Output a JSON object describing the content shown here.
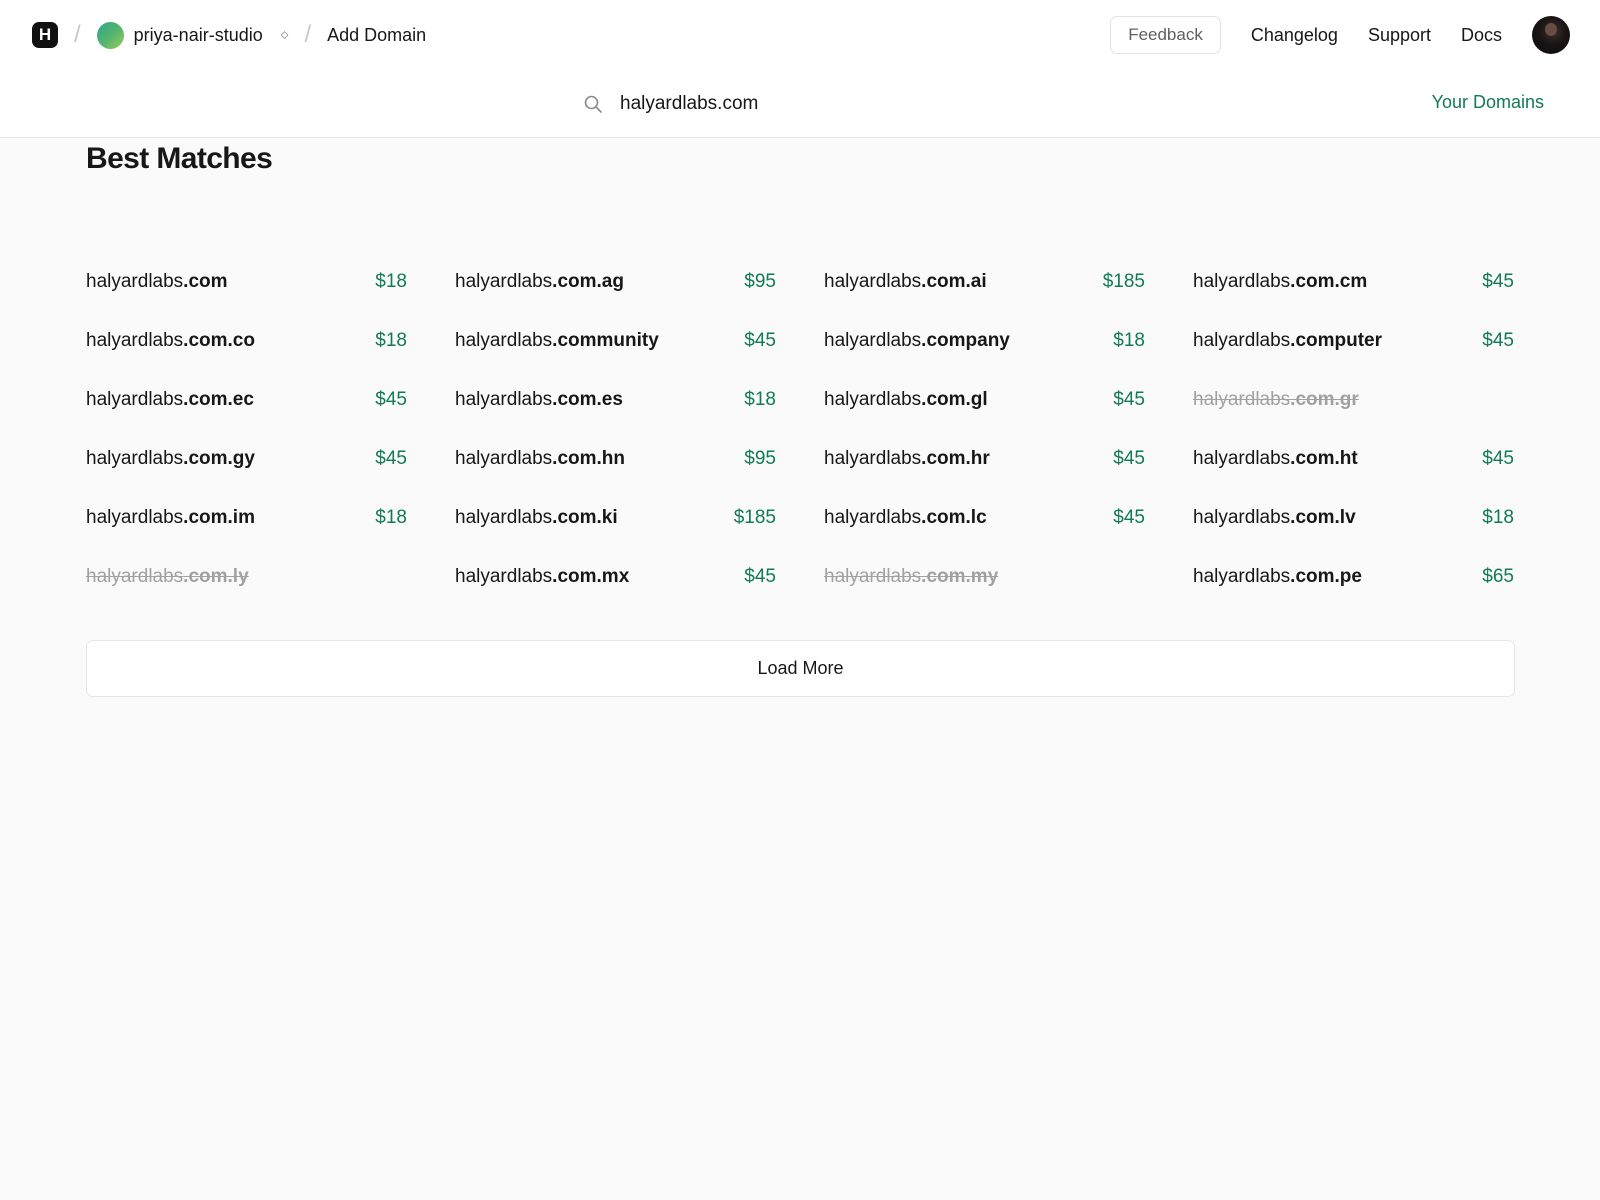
{
  "nav": {
    "logo_letter": "H",
    "team_name": "priya-nair-studio",
    "team_switch_glyph": "⬦",
    "page": "Add Domain",
    "feedback": "Feedback",
    "links": [
      "Changelog",
      "Support",
      "Docs"
    ]
  },
  "search": {
    "query": "halyardlabs.com",
    "your_domains": "Your Domains"
  },
  "section_title": "Best Matches",
  "results": [
    {
      "base": "halyardlabs",
      "tld": ".com",
      "price": "$18",
      "available": true
    },
    {
      "base": "halyardlabs",
      "tld": ".com.ag",
      "price": "$95",
      "available": true
    },
    {
      "base": "halyardlabs",
      "tld": ".com.ai",
      "price": "$185",
      "available": true
    },
    {
      "base": "halyardlabs",
      "tld": ".com.cm",
      "price": "$45",
      "available": true
    },
    {
      "base": "halyardlabs",
      "tld": ".com.co",
      "price": "$18",
      "available": true
    },
    {
      "base": "halyardlabs",
      "tld": ".community",
      "price": "$45",
      "available": true
    },
    {
      "base": "halyardlabs",
      "tld": ".company",
      "price": "$18",
      "available": true
    },
    {
      "base": "halyardlabs",
      "tld": ".computer",
      "price": "$45",
      "available": true
    },
    {
      "base": "halyardlabs",
      "tld": ".com.ec",
      "price": "$45",
      "available": true
    },
    {
      "base": "halyardlabs",
      "tld": ".com.es",
      "price": "$18",
      "available": true
    },
    {
      "base": "halyardlabs",
      "tld": ".com.gl",
      "price": "$45",
      "available": true
    },
    {
      "base": "halyardlabs",
      "tld": ".com.gr",
      "price": "",
      "available": false
    },
    {
      "base": "halyardlabs",
      "tld": ".com.gy",
      "price": "$45",
      "available": true
    },
    {
      "base": "halyardlabs",
      "tld": ".com.hn",
      "price": "$95",
      "available": true
    },
    {
      "base": "halyardlabs",
      "tld": ".com.hr",
      "price": "$45",
      "available": true
    },
    {
      "base": "halyardlabs",
      "tld": ".com.ht",
      "price": "$45",
      "available": true
    },
    {
      "base": "halyardlabs",
      "tld": ".com.im",
      "price": "$18",
      "available": true
    },
    {
      "base": "halyardlabs",
      "tld": ".com.ki",
      "price": "$185",
      "available": true
    },
    {
      "base": "halyardlabs",
      "tld": ".com.lc",
      "price": "$45",
      "available": true
    },
    {
      "base": "halyardlabs",
      "tld": ".com.lv",
      "price": "$18",
      "available": true
    },
    {
      "base": "halyardlabs",
      "tld": ".com.ly",
      "price": "",
      "available": false
    },
    {
      "base": "halyardlabs",
      "tld": ".com.mx",
      "price": "$45",
      "available": true
    },
    {
      "base": "halyardlabs",
      "tld": ".com.my",
      "price": "",
      "available": false
    },
    {
      "base": "halyardlabs",
      "tld": ".com.pe",
      "price": "$65",
      "available": true
    }
  ],
  "load_more": "Load More",
  "colors": {
    "accent": "#127a55",
    "background": "#fafafa",
    "unavailable": "#a1a1a1"
  }
}
